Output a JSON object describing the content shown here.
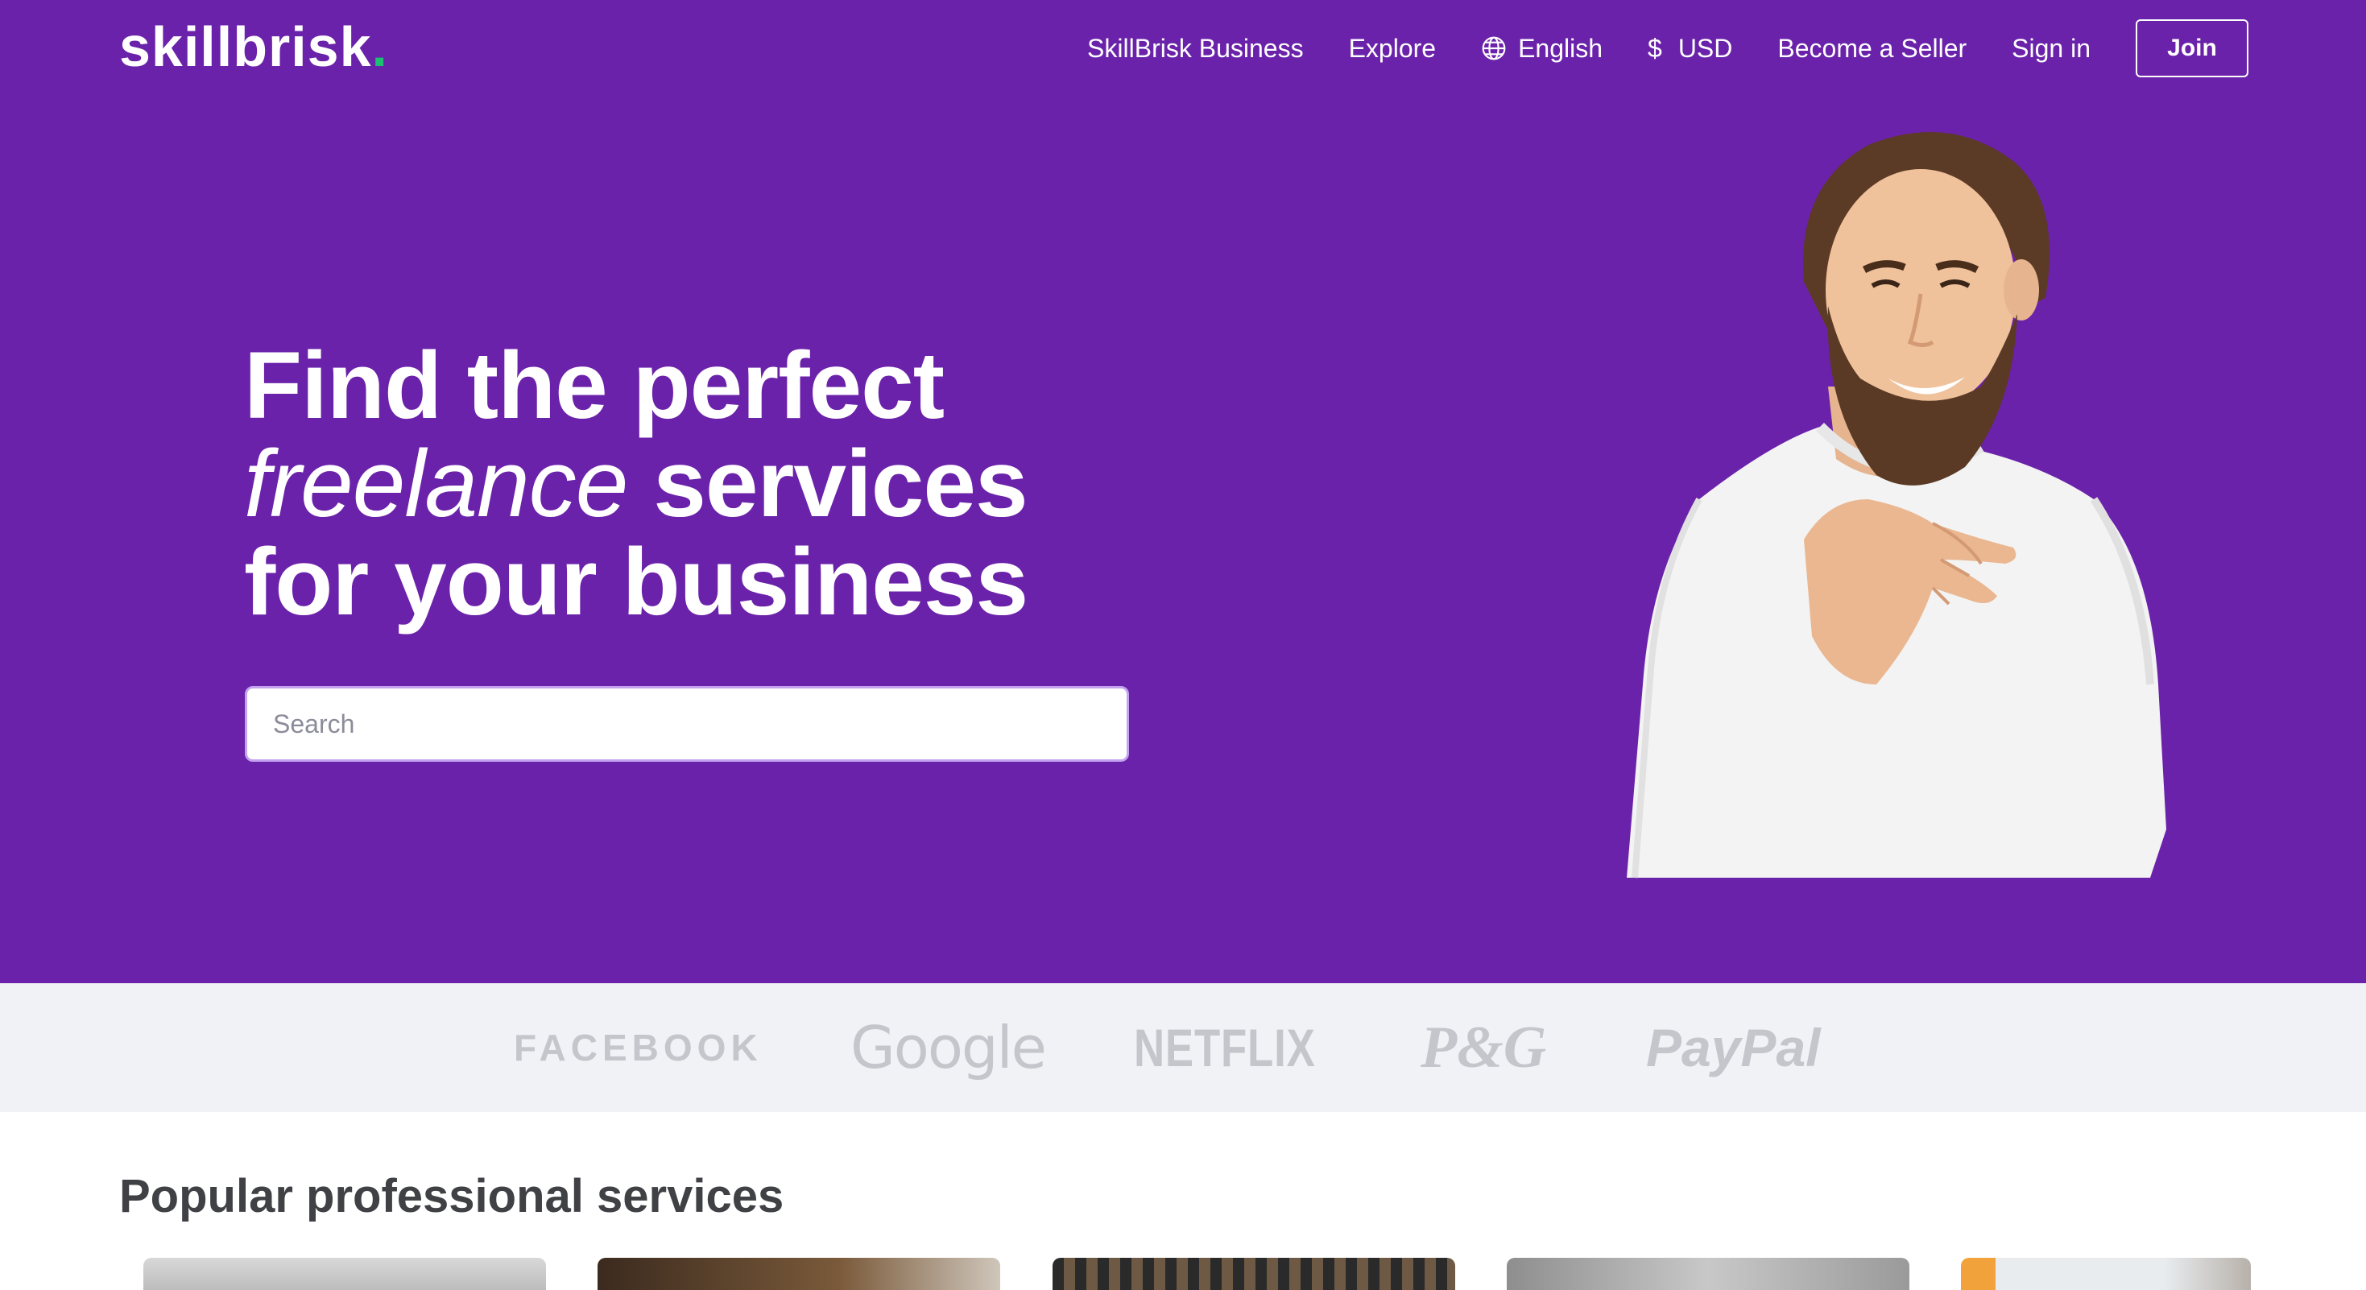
{
  "brand": {
    "name": "skillbrisk",
    "dot": "."
  },
  "nav": {
    "business": "SkillBrisk Business",
    "explore": "Explore",
    "language": "English",
    "currency_symbol": "$",
    "currency": "USD",
    "become_seller": "Become a Seller",
    "sign_in": "Sign in",
    "join": "Join"
  },
  "hero": {
    "line1": "Find the perfect",
    "line2_italic": "freelance",
    "line2_rest": " services",
    "line3": "for your business",
    "search_placeholder": "Search"
  },
  "trusted_by": [
    "FACEBOOK",
    "Google",
    "NETFLIX",
    "P&G",
    "PayPal"
  ],
  "popular": {
    "title": "Popular professional services"
  },
  "colors": {
    "hero_bg": "#6b22aa",
    "logo_dot": "#1dbf73",
    "brand_text": "#c4c6cc",
    "strip_bg": "#f1f2f5"
  },
  "icons": {
    "language": "globe-icon"
  }
}
